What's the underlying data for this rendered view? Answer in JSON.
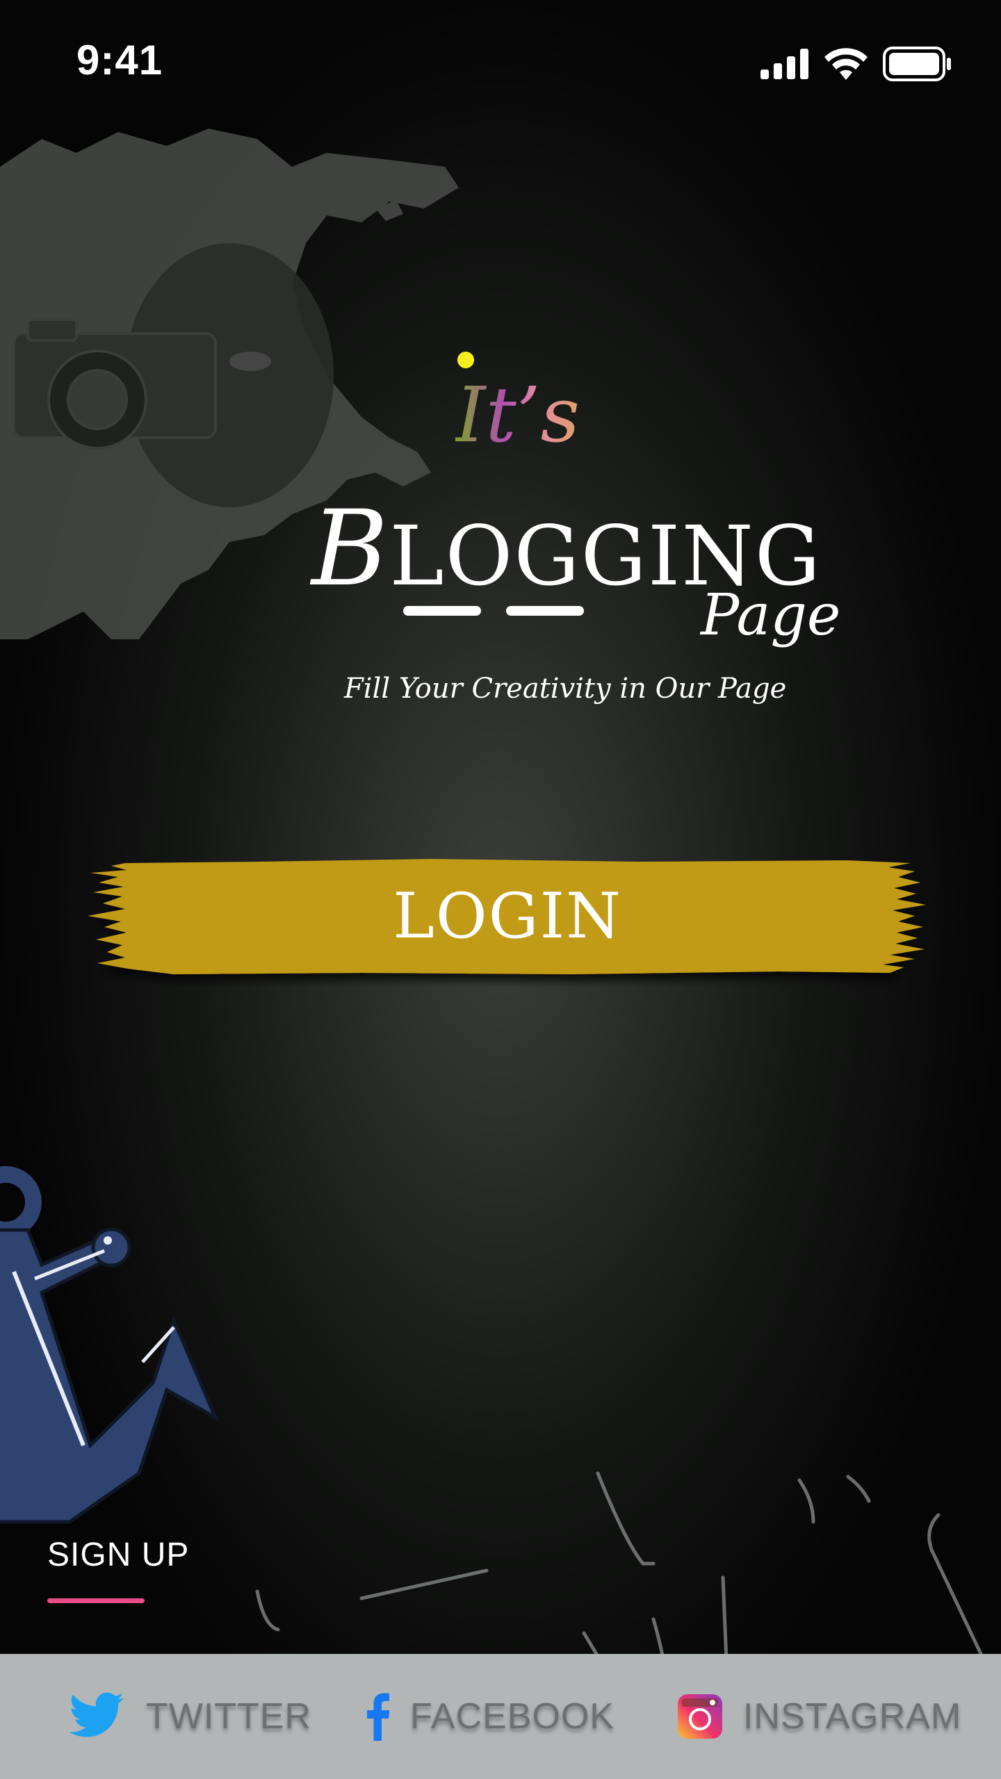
{
  "status_bar": {
    "time": "9:41"
  },
  "logo": {
    "its": "It’s",
    "title_initial": "B",
    "title_rest": "LOGGING",
    "subtitle_word": "Page",
    "tagline": "Fill Your Creativity in Our Page"
  },
  "login": {
    "label": "LOGIN",
    "color": "#c19a14"
  },
  "signup": {
    "label": "SIGN UP",
    "underline_color": "#ea4c8a"
  },
  "social": {
    "twitter": {
      "label": "TWITTER",
      "icon": "twitter-bird-icon",
      "color": "#1da1f2"
    },
    "facebook": {
      "label": "FACEBOOK",
      "icon": "facebook-f-icon",
      "color": "#1877f2"
    },
    "instagram": {
      "label": "INSTAGRAM",
      "icon": "instagram-camera-icon"
    }
  }
}
